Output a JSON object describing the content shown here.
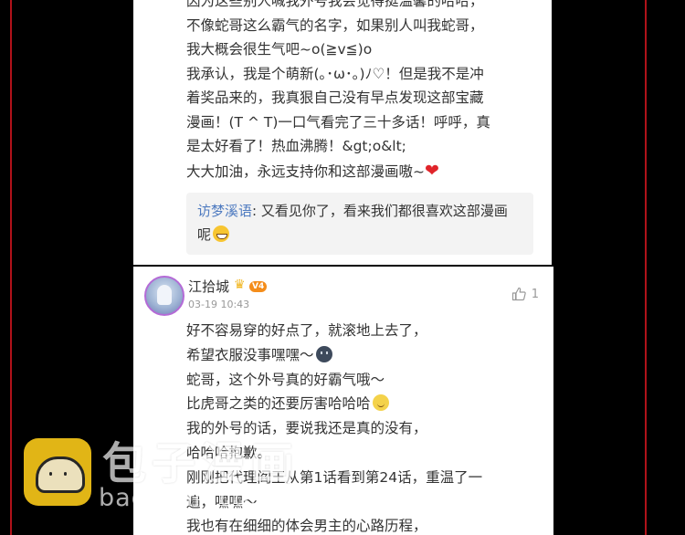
{
  "colors": {
    "background": "#000000",
    "edge_line": "#b0121a",
    "panel": "#ffffff",
    "reply_name": "#4f7bc0",
    "vip_badge": "#f48d1b",
    "watermark_icon": "#f5c518"
  },
  "comment_top": {
    "lines": [
      "因为这些别人喊我外号我会觉得挺温馨的哈哈，",
      "不像蛇哥这么霸气的名字，如果别人叫我蛇哥，",
      "我大概会很生气吧~o(≧v≦)o",
      "我承认，我是个萌新(｡･ω･｡)ﾉ♡！但是我不是冲",
      "着奖品来的，我真狠自己没有早点发现这部宝藏",
      "漫画！(T ^ T)一口气看完了三十多话！呼呼，真",
      "是太好看了！热血沸腾！&gt;o&lt;",
      "大大加油，永远支持你和这部漫画嗷~"
    ],
    "last_line_emoji": "red-heart-icon",
    "reply": {
      "author": "访梦溪语",
      "separator": ": ",
      "text_line1": "又看见你了，看来我们都很喜欢这部漫画",
      "text_line2": "呢",
      "emoji": "grinning-face-icon"
    }
  },
  "comment_bottom": {
    "user_name": "江拾城",
    "vip_label": "V4",
    "crown_icon": "crown-icon",
    "timestamp": "03-19 10:43",
    "likes": "1",
    "like_icon": "thumbs-up-icon",
    "lines": [
      {
        "text": "好不容易穿的好点了，就滚地上去了，",
        "emoji": null
      },
      {
        "text": "希望衣服没事嘿嘿～",
        "emoji": "dark-face-icon"
      },
      {
        "text": "蛇哥，这个外号真的好霸气哦～",
        "emoji": null
      },
      {
        "text": "比虎哥之类的还要厉害哈哈哈",
        "emoji": "smiling-face-icon"
      },
      {
        "text": "我的外号的话，要说我还是真的没有，",
        "emoji": null
      },
      {
        "text": "哈哈哈抱歉。",
        "emoji": null
      },
      {
        "text": "刚刚把代理阎王从第1话看到第24话，重温了一",
        "emoji": null
      },
      {
        "text": "遍，嘿嘿～",
        "emoji": null
      },
      {
        "text": "我也有在细细的体会男主的心路历程，",
        "emoji": null
      }
    ]
  },
  "watermark": {
    "title": "包子漫画",
    "url": "baozimh.com",
    "icon": "baozi-bun-icon"
  }
}
